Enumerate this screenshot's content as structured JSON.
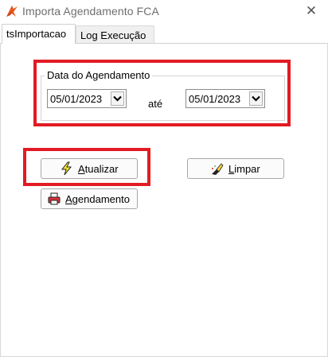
{
  "window": {
    "title": "Importa Agendamento FCA",
    "close_glyph": "✕"
  },
  "tabs": [
    {
      "label": "tsImportacao",
      "active": true
    },
    {
      "label": "Log Execução",
      "active": false
    }
  ],
  "date_group": {
    "legend": "Data do Agendamento",
    "from_date": "05/01/2023",
    "separator_label": "até",
    "to_date": "05/01/2023"
  },
  "buttons": {
    "atualizar": {
      "mnemonic": "A",
      "rest": "tualizar",
      "icon": "lightning-icon"
    },
    "limpar": {
      "mnemonic": "L",
      "rest": "impar",
      "icon": "eraser-icon"
    },
    "agendamento": {
      "mnemonic": "A",
      "rest": "gendamento",
      "icon": "printer-icon"
    }
  },
  "colors": {
    "highlight_red": "#e21b23",
    "app_icon_orange": "#e8541f"
  }
}
